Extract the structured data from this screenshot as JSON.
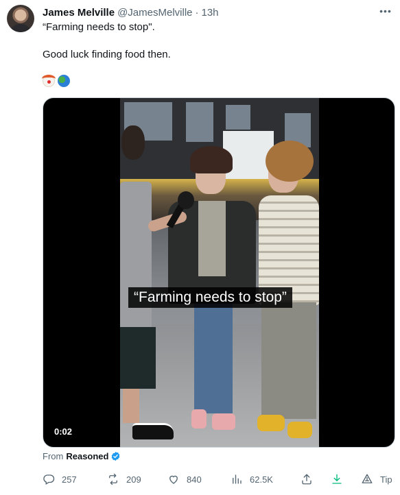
{
  "tweet": {
    "author_name": "James Melville",
    "handle": "@JamesMelville",
    "separator": "·",
    "time": "13h",
    "text_line_1": "“Farming needs to stop\".",
    "text_line_2": "Good luck finding food then.",
    "emojis": [
      "clown-face",
      "globe-showing-africa"
    ],
    "more_icon": "ellipsis-icon"
  },
  "media": {
    "caption": "“Farming needs to stop”",
    "timestamp": "0:02"
  },
  "source": {
    "label": "From",
    "name": "Reasoned",
    "verified_color": "#1d9bf0"
  },
  "actions": {
    "replies": "257",
    "reposts": "209",
    "likes": "840",
    "views": "62.5K",
    "tip_label": "Tip",
    "download_color": "#00ba7c"
  },
  "colors": {
    "text": "#0f1419",
    "muted": "#536471",
    "accent": "#1d9bf0"
  }
}
